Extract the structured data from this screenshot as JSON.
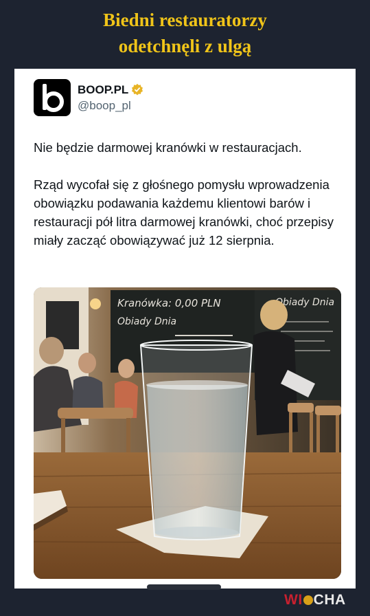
{
  "headline": {
    "line1": "Biedni restauratorzy",
    "line2": "odetchnęli z ulgą"
  },
  "post": {
    "account_name": "BOOP.PL",
    "handle": "@boop_pl",
    "avatar_icon": "boop-logo-icon",
    "verified_icon": "verified-badge-icon",
    "paragraph1": "Nie będzie darmowej kranówki w restauracjach.",
    "paragraph2": "Rząd wycofał się z głośnego pomysłu wprowadzenia obowiązku podawania każdemu klientowi barów i restauracji pół litra darmowej kranówki, choć przepisy miały zacząć obowiązywać już 12 sierpnia.",
    "image": {
      "board_text_1": "Kranówka: 0,00 PLN",
      "board_text_2": "Obiady Dnia",
      "board_text_3": "Obiady Dnia"
    }
  },
  "watermark": {
    "w": "W",
    "i": "I",
    "rest": "CHA"
  },
  "colors": {
    "background": "#1d2330",
    "headline": "#f0c419",
    "card": "#ffffff",
    "watermark_accent": "#c8202f"
  }
}
